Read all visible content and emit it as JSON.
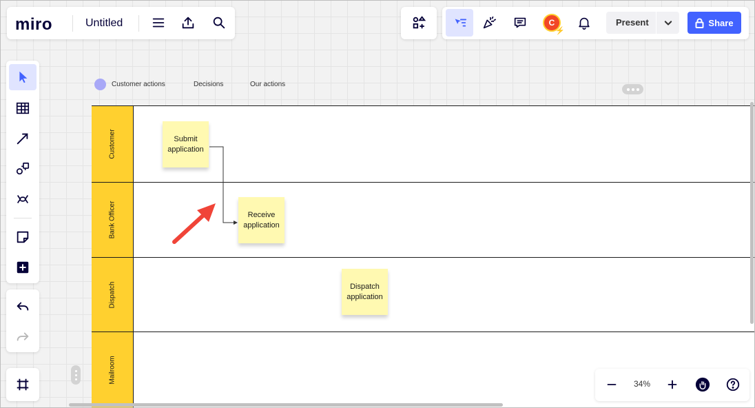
{
  "app": {
    "logo": "miro",
    "board_title": "Untitled"
  },
  "header": {
    "present_label": "Present",
    "share_label": "Share",
    "avatar_initial": "C"
  },
  "legend": {
    "items": [
      "Customer actions",
      "Decisions",
      "Our actions"
    ]
  },
  "lanes": [
    {
      "label": "Customer"
    },
    {
      "label": "Bank Officer"
    },
    {
      "label": "Dispatch"
    },
    {
      "label": "Mailroom"
    }
  ],
  "stickies": [
    {
      "text": "Submit application"
    },
    {
      "text": "Receive application"
    },
    {
      "text": "Dispatch application"
    }
  ],
  "zoom": {
    "level": "34%"
  },
  "colors": {
    "accent": "#4262ff",
    "lane_header": "#ffd02f",
    "sticky": "#fff9b1",
    "annotation_arrow": "#f04438"
  }
}
